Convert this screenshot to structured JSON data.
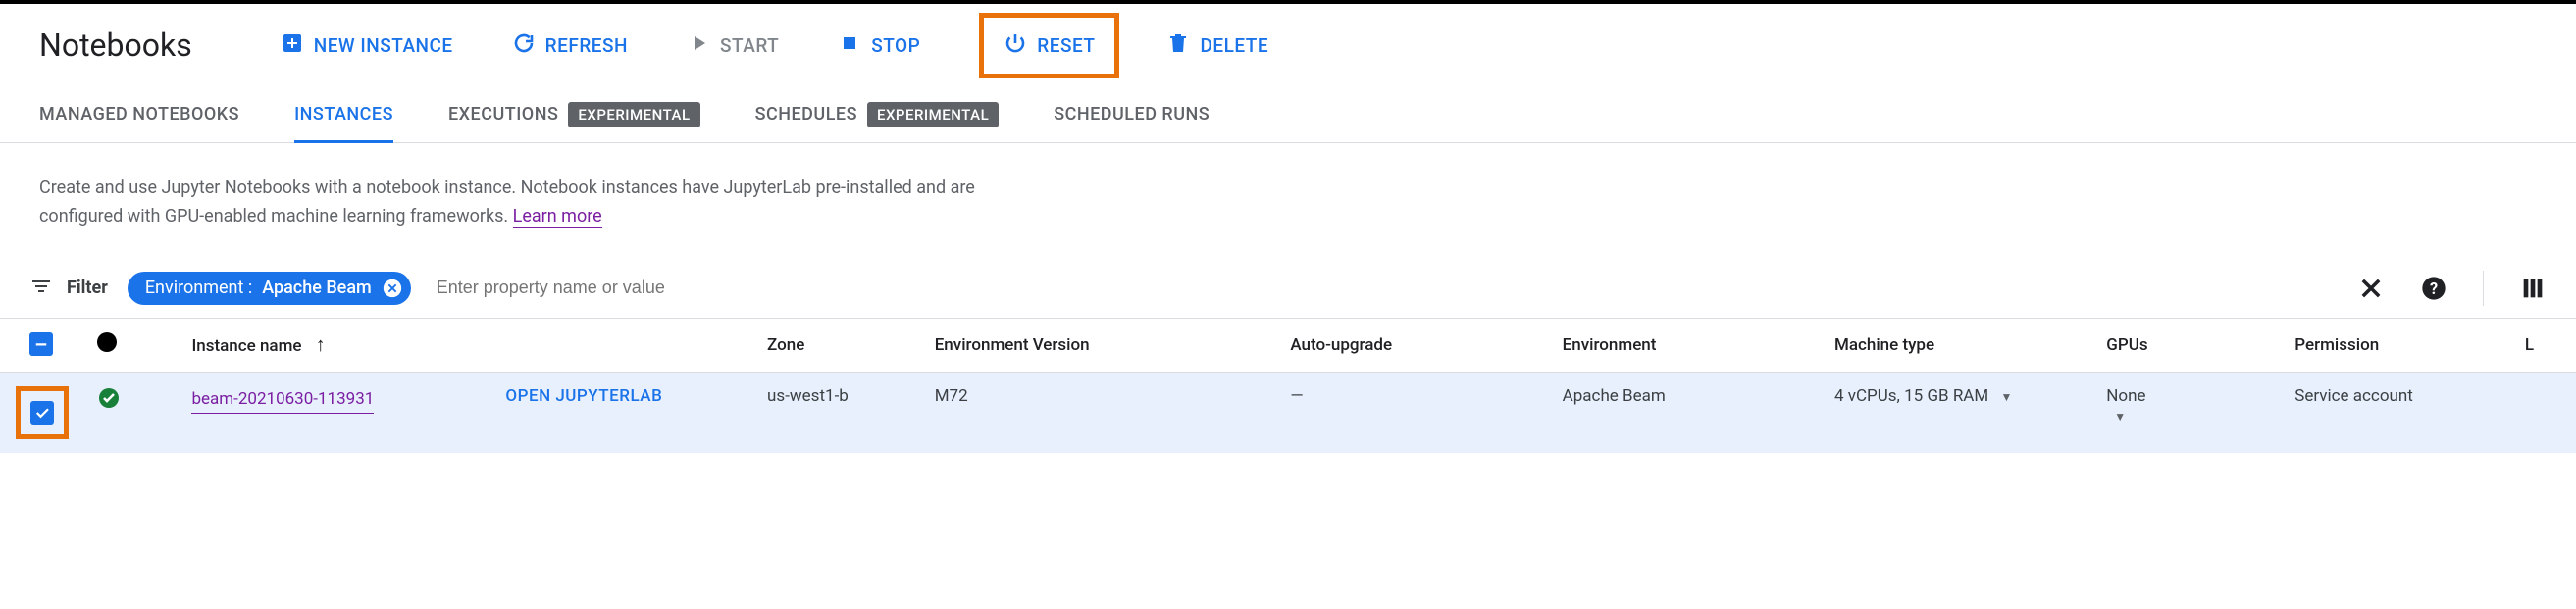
{
  "page": {
    "title": "Notebooks"
  },
  "toolbar": {
    "new_instance": "NEW INSTANCE",
    "refresh": "REFRESH",
    "start": "START",
    "stop": "STOP",
    "reset": "RESET",
    "delete": "DELETE"
  },
  "tabs": {
    "managed": "MANAGED NOTEBOOKS",
    "instances": "INSTANCES",
    "executions": "EXECUTIONS",
    "schedules": "SCHEDULES",
    "scheduled_runs": "SCHEDULED RUNS",
    "experimental_badge": "EXPERIMENTAL"
  },
  "description": {
    "text": "Create and use Jupyter Notebooks with a notebook instance. Notebook instances have JupyterLab pre-installed and are configured with GPU-enabled machine learning frameworks.",
    "learn_more": "Learn more"
  },
  "filter": {
    "label": "Filter",
    "chip_key": "Environment :",
    "chip_value": "Apache Beam",
    "placeholder": "Enter property name or value"
  },
  "columns": {
    "instance_name": "Instance name",
    "zone": "Zone",
    "environment_version": "Environment Version",
    "auto_upgrade": "Auto-upgrade",
    "environment": "Environment",
    "machine_type": "Machine type",
    "gpus": "GPUs",
    "permission": "Permission",
    "last_col": "L"
  },
  "rows": [
    {
      "name": "beam-20210630-113931",
      "open_label": "OPEN JUPYTERLAB",
      "zone": "us-west1-b",
      "env_version": "M72",
      "auto_upgrade": "—",
      "environment": "Apache Beam",
      "machine_type": "4 vCPUs, 15 GB RAM",
      "gpus": "None",
      "permission": "Service account"
    }
  ]
}
